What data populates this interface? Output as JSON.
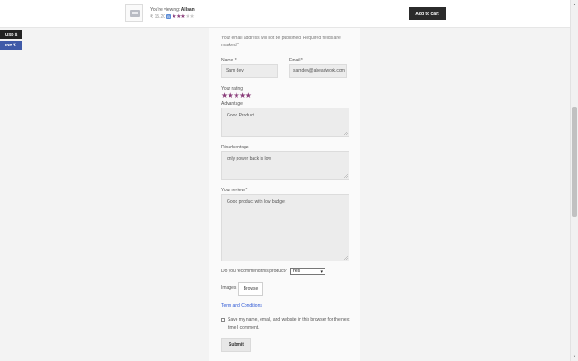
{
  "sticky_header": {
    "viewing_prefix": "You're viewing:",
    "product_name": "Allsan",
    "price": "₹ 15.20",
    "badge": "B",
    "rating_filled": 3,
    "rating_total": 5,
    "add_to_cart_label": "Add to cart"
  },
  "currency": {
    "usd": "USD $",
    "inr": "INR ₹"
  },
  "form": {
    "note": "Your email address will not be published. Required fields are marked *",
    "name_label": "Name *",
    "name_value": "Sam dev",
    "email_label": "Email *",
    "email_value": "samdev@aheadwork.com",
    "rating_label": "Your rating",
    "rating_value": 5,
    "advantage_label": "Advantage",
    "advantage_value": "Good Product",
    "disadvantage_label": "Disadvantage",
    "disadvantage_value": "only power back is low",
    "review_label": "Your review *",
    "review_value": "Good product with low budget",
    "recommend_label": "Do you recommend this product?",
    "recommend_value": "Yes",
    "images_label": "Images",
    "browse_label": "Browse",
    "terms_label": "Term and Conditions",
    "save_info_label": "Save my name, email, and website in this browser for the next time I comment.",
    "submit_label": "Submit"
  },
  "colors": {
    "star": "#8a3d7a",
    "link": "#2a55d4",
    "cart_button": "#2b2b2b",
    "usd_badge": "#222222",
    "inr_badge": "#3f5aa8"
  }
}
